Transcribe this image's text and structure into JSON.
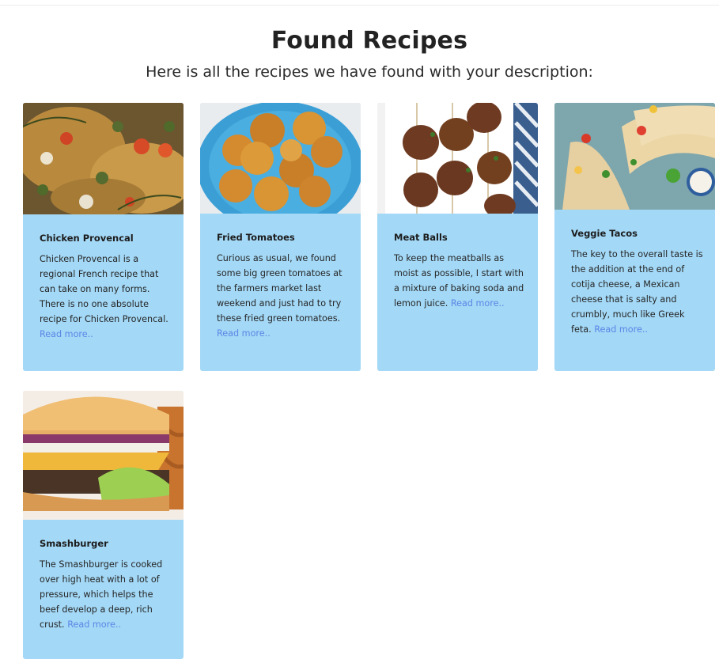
{
  "header": {
    "title": "Found Recipes",
    "subtitle": "Here is all the recipes we have found with your description:"
  },
  "colors": {
    "card_background": "#a3d8f6",
    "link": "#5b86e6",
    "title_text": "#222222"
  },
  "recipes": [
    {
      "title": "Chicken Provencal",
      "description": "Chicken Provencal is a regional French recipe that can take on many forms. There is no one absolute recipe for Chicken Provencal.",
      "link_label": "Read more..",
      "image": "chicken-provencal-photo"
    },
    {
      "title": "Fried Tomatoes",
      "description": "Curious as usual, we found some big green tomatoes at the farmers market last weekend and just had to try these fried green tomatoes.",
      "link_label": "Read more..",
      "image": "fried-tomatoes-photo"
    },
    {
      "title": "Meat Balls",
      "description": "To keep the meatballs as moist as possible, I start with a mixture of baking soda and lemon juice.",
      "link_label": "Read more..",
      "image": "meat-balls-photo"
    },
    {
      "title": "Veggie Tacos",
      "description": "The key to the overall taste is the addition at the end of cotija cheese, a Mexican cheese that is salty and crumbly, much like Greek feta.",
      "link_label": "Read more..",
      "image": "veggie-tacos-photo"
    },
    {
      "title": "Smashburger",
      "description": "The Smashburger is cooked over high heat with a lot of pressure, which helps the beef develop a deep, rich crust.",
      "link_label": "Read more..",
      "image": "smashburger-photo"
    }
  ]
}
